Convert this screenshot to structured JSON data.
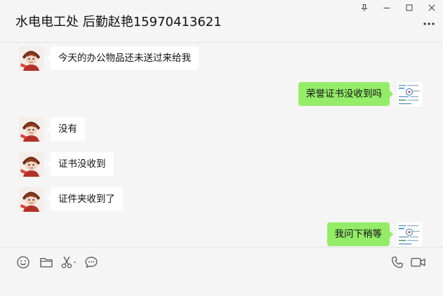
{
  "chat": {
    "title": "水电电工处 后勤赵艳15970413621"
  },
  "messages": [
    {
      "side": "left",
      "text": "今天的办公物品还未送过来给我"
    },
    {
      "side": "right",
      "text": "荣誉证书没收到吗"
    },
    {
      "side": "left",
      "text": "没有"
    },
    {
      "side": "left",
      "text": "证书没收到"
    },
    {
      "side": "left",
      "text": "证件夹收到了"
    },
    {
      "side": "right",
      "text": "我问下稍等"
    }
  ],
  "icons": {
    "pin": "pin-icon",
    "minimize": "minimize-icon",
    "maximize": "maximize-icon",
    "close": "close-icon",
    "more": "more-icon",
    "emoji": "emoji-icon",
    "folder": "folder-icon",
    "scissors": "scissors-icon",
    "chat_history": "chat-bubble-icon",
    "voice_call": "phone-icon",
    "video_call": "video-camera-icon"
  },
  "colors": {
    "background": "#f5f5f5",
    "incoming_bubble": "#ffffff",
    "outgoing_bubble": "#95ec69",
    "icon": "#555555"
  }
}
